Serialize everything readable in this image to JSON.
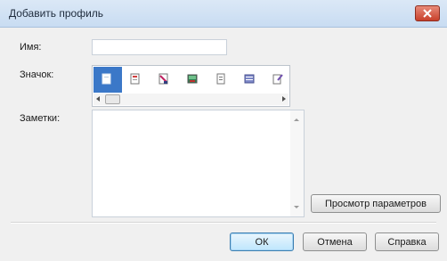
{
  "dialog": {
    "title": "Добавить профиль",
    "name_label": "Имя:",
    "name_value": "",
    "icon_label": "Значок:",
    "notes_label": "Заметки:",
    "notes_value": "",
    "icons": [
      "profile-icon-1",
      "profile-icon-2",
      "profile-icon-3",
      "profile-icon-4",
      "profile-icon-5",
      "profile-icon-6",
      "profile-icon-7"
    ],
    "selected_icon_index": 0,
    "preview_button": "Просмотр параметров",
    "ok_button": "ОК",
    "cancel_button": "Отмена",
    "help_button": "Справка"
  },
  "colors": {
    "selection": "#3b78c8",
    "close": "#c8402b"
  }
}
